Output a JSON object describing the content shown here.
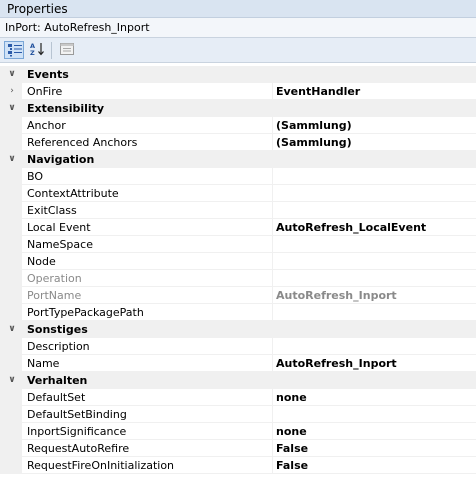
{
  "window": {
    "title": "Properties"
  },
  "object_selector": {
    "label": "InPort: AutoRefresh_Inport"
  },
  "toolbar": {
    "categorized_icon": "categorized-icon",
    "alphabetical_icon": "alphabetical-sort-icon",
    "property_pages_icon": "property-pages-icon"
  },
  "categories": [
    {
      "name": "Events",
      "expanded": true,
      "props": [
        {
          "name": "OnFire",
          "value": "EventHandler",
          "bold": true,
          "expandable": true
        }
      ]
    },
    {
      "name": "Extensibility",
      "expanded": true,
      "props": [
        {
          "name": "Anchor",
          "value": "(Sammlung)",
          "bold": true
        },
        {
          "name": "Referenced Anchors",
          "value": "(Sammlung)",
          "bold": true
        }
      ]
    },
    {
      "name": "Navigation",
      "expanded": true,
      "props": [
        {
          "name": "BO",
          "value": ""
        },
        {
          "name": "ContextAttribute",
          "value": ""
        },
        {
          "name": "ExitClass",
          "value": ""
        },
        {
          "name": "Local Event",
          "value": "AutoRefresh_LocalEvent",
          "bold": true
        },
        {
          "name": "NameSpace",
          "value": ""
        },
        {
          "name": "Node",
          "value": ""
        },
        {
          "name": "Operation",
          "value": "",
          "readonly": true
        },
        {
          "name": "PortName",
          "value": "AutoRefresh_Inport",
          "bold": true,
          "readonly": true
        },
        {
          "name": "PortTypePackagePath",
          "value": ""
        }
      ]
    },
    {
      "name": "Sonstiges",
      "expanded": true,
      "props": [
        {
          "name": "Description",
          "value": ""
        },
        {
          "name": "Name",
          "value": "AutoRefresh_Inport",
          "bold": true
        }
      ]
    },
    {
      "name": "Verhalten",
      "expanded": true,
      "props": [
        {
          "name": "DefaultSet",
          "value": "none",
          "bold": true
        },
        {
          "name": "DefaultSetBinding",
          "value": ""
        },
        {
          "name": "InportSignificance",
          "value": "none",
          "bold": true
        },
        {
          "name": "RequestAutoRefire",
          "value": "False",
          "bold": true
        },
        {
          "name": "RequestFireOnInitialization",
          "value": "False",
          "bold": true
        }
      ]
    }
  ]
}
